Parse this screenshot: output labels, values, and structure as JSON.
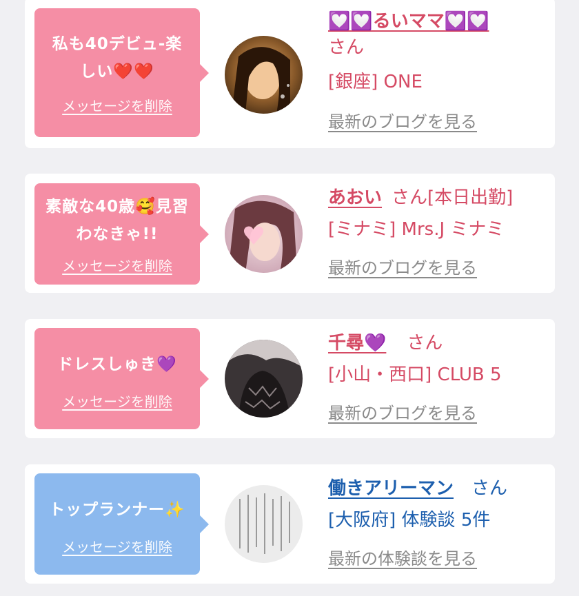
{
  "messages": [
    {
      "message": "私も40デビュ-楽しい❤️❤️",
      "delete_label": "メッセージを削除",
      "name": "💟💟るいママ💟💟",
      "suffix": "さん",
      "place": "[銀座] ONE",
      "link_label": "最新のブログを見る",
      "style": "pink"
    },
    {
      "message": "素敵な40歳🥰見習わなきゃ!!",
      "delete_label": "メッセージを削除",
      "name": "あおい",
      "suffix": "さん[本日出勤]",
      "place": "[ミナミ] Mrs.J ミナミ",
      "link_label": "最新のブログを見る",
      "style": "pink"
    },
    {
      "message": "ドレスしゅき💜",
      "delete_label": "メッセージを削除",
      "name": "千尋💜",
      "suffix": "さん",
      "place": "[小山・西口] CLUB 5",
      "link_label": "最新のブログを見る",
      "style": "pink"
    },
    {
      "message": "トップランナー✨",
      "delete_label": "メッセージを削除",
      "name": "働きアリーマン",
      "suffix": "さん",
      "place": "[大阪府] 体験談 5件",
      "link_label": "最新の体験談を見る",
      "style": "blue"
    }
  ],
  "colors": {
    "pink_bubble": "#f58ea5",
    "blue_bubble": "#8cb9ee",
    "pink_text": "#d54a64",
    "blue_text": "#1d5fae",
    "link_gray": "#8a8a8a",
    "background": "#f0f0f3"
  }
}
